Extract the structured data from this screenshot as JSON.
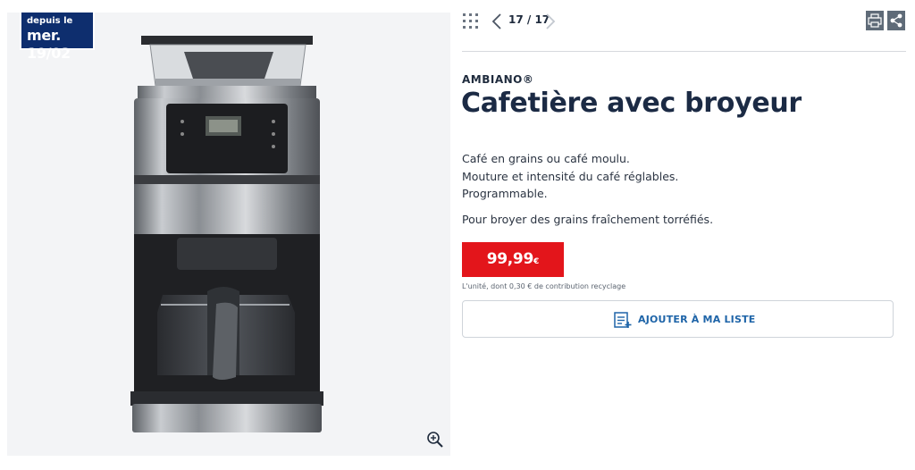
{
  "badge": {
    "line1": "depuis le",
    "line2": "mer. 19/02"
  },
  "gallery": {
    "pager": "17 / 17"
  },
  "product": {
    "brand": "AMBIANO®",
    "title": "Cafetière avec broyeur",
    "description": [
      "Café en grains ou café moulu.",
      "Mouture et intensité du café réglables.",
      "Programmable."
    ],
    "tagline": "Pour broyer des grains fraîchement torréfiés.",
    "price": "99,99",
    "currency": "€",
    "price_note": "L'unité, dont 0,30 € de contribution recyclage"
  },
  "actions": {
    "add_to_list": "AJOUTER À MA LISTE"
  },
  "icons": [
    "grid-icon",
    "chevron-left-icon",
    "chevron-right-icon",
    "print-icon",
    "share-icon",
    "zoom-in-icon",
    "add-to-list-icon"
  ],
  "colors": {
    "navy": "#0e2e6e",
    "price_red": "#e3151b",
    "link_blue": "#1e64a8"
  }
}
